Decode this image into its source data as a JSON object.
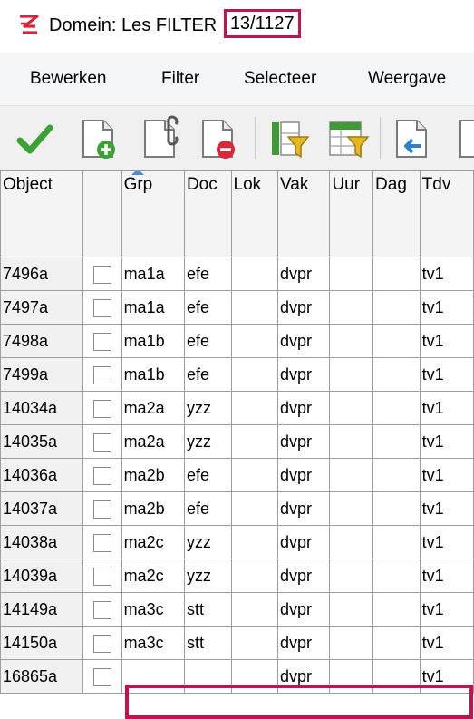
{
  "window": {
    "title_prefix": "Domein: Les FILTER",
    "title_count": "13/1127"
  },
  "menu": {
    "items": [
      "Bewerken",
      "Filter",
      "Selecteer",
      "Weergave"
    ]
  },
  "toolbar": {
    "icons": [
      "checkmark-icon",
      "new-document-icon",
      "edit-document-icon",
      "delete-document-icon",
      "column-filter-icon",
      "table-filter-icon",
      "back-document-icon",
      "partial-document-icon"
    ]
  },
  "grid": {
    "columns": [
      "Object",
      "",
      "Grp",
      "Doc",
      "Lok",
      "Vak",
      "Uur",
      "Dag",
      "Tdv"
    ],
    "sorted_column": "Grp",
    "rows": [
      {
        "object": "7496a",
        "grp": "ma1a",
        "doc": "efe",
        "lok": "",
        "vak": "dvpr",
        "uur": "",
        "dag": "",
        "tdv": "tv1"
      },
      {
        "object": "7497a",
        "grp": "ma1a",
        "doc": "efe",
        "lok": "",
        "vak": "dvpr",
        "uur": "",
        "dag": "",
        "tdv": "tv1"
      },
      {
        "object": "7498a",
        "grp": "ma1b",
        "doc": "efe",
        "lok": "",
        "vak": "dvpr",
        "uur": "",
        "dag": "",
        "tdv": "tv1"
      },
      {
        "object": "7499a",
        "grp": "ma1b",
        "doc": "efe",
        "lok": "",
        "vak": "dvpr",
        "uur": "",
        "dag": "",
        "tdv": "tv1"
      },
      {
        "object": "14034a",
        "grp": "ma2a",
        "doc": "yzz",
        "lok": "",
        "vak": "dvpr",
        "uur": "",
        "dag": "",
        "tdv": "tv1"
      },
      {
        "object": "14035a",
        "grp": "ma2a",
        "doc": "yzz",
        "lok": "",
        "vak": "dvpr",
        "uur": "",
        "dag": "",
        "tdv": "tv1"
      },
      {
        "object": "14036a",
        "grp": "ma2b",
        "doc": "efe",
        "lok": "",
        "vak": "dvpr",
        "uur": "",
        "dag": "",
        "tdv": "tv1"
      },
      {
        "object": "14037a",
        "grp": "ma2b",
        "doc": "efe",
        "lok": "",
        "vak": "dvpr",
        "uur": "",
        "dag": "",
        "tdv": "tv1"
      },
      {
        "object": "14038a",
        "grp": "ma2c",
        "doc": "yzz",
        "lok": "",
        "vak": "dvpr",
        "uur": "",
        "dag": "",
        "tdv": "tv1"
      },
      {
        "object": "14039a",
        "grp": "ma2c",
        "doc": "yzz",
        "lok": "",
        "vak": "dvpr",
        "uur": "",
        "dag": "",
        "tdv": "tv1"
      },
      {
        "object": "14149a",
        "grp": "ma3c",
        "doc": "stt",
        "lok": "",
        "vak": "dvpr",
        "uur": "",
        "dag": "",
        "tdv": "tv1"
      },
      {
        "object": "14150a",
        "grp": "ma3c",
        "doc": "stt",
        "lok": "",
        "vak": "dvpr",
        "uur": "",
        "dag": "",
        "tdv": "tv1"
      },
      {
        "object": "16865a",
        "grp": "",
        "doc": "",
        "lok": "",
        "vak": "dvpr",
        "uur": "",
        "dag": "",
        "tdv": "tv1"
      }
    ]
  },
  "colors": {
    "highlight": "#c0144c",
    "grid_line": "#9d9d9d",
    "menubar_bg": "#f5f6f7",
    "toolbar_bg": "#f0f0f0"
  }
}
